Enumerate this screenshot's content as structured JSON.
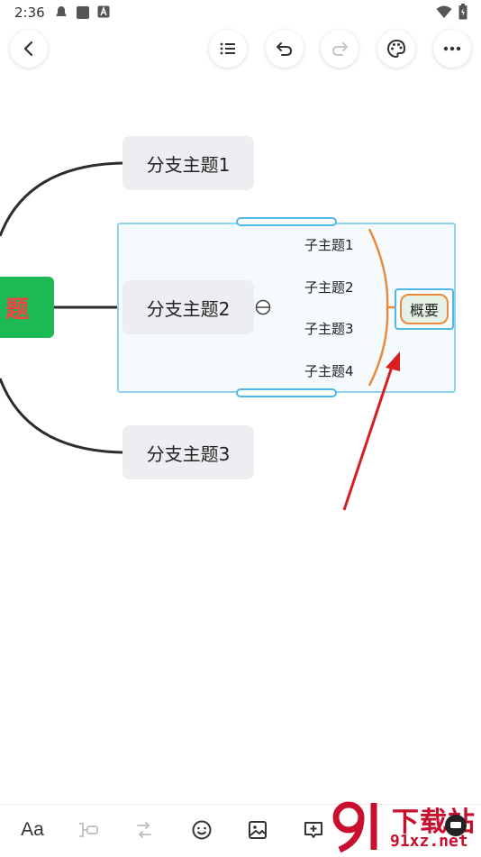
{
  "status_bar": {
    "time": "2:36"
  },
  "toolbar": {
    "back": "back-icon",
    "outline": "list-icon",
    "undo": "undo-icon",
    "redo": "redo-icon",
    "theme": "palette-icon",
    "more": "more-icon"
  },
  "mindmap": {
    "root_label": "题",
    "branches": [
      {
        "label": "分支主题1"
      },
      {
        "label": "分支主题2"
      },
      {
        "label": "分支主题3"
      }
    ],
    "subtopics": [
      {
        "label": "子主题1"
      },
      {
        "label": "子主题2"
      },
      {
        "label": "子主题3"
      },
      {
        "label": "子主题4"
      }
    ],
    "summary_label": "概要"
  },
  "bottom_toolbar": {
    "font_label": "Aa",
    "icons": [
      "subtopic-icon",
      "relationship-icon",
      "emoji-icon",
      "image-icon",
      "comment-icon"
    ]
  },
  "watermark": {
    "brand": "下载站",
    "url": "91xz.net"
  },
  "colors": {
    "root": "#1db954",
    "root_text": "#ee4444",
    "selection": "#8fd3ef",
    "summary_bracket": "#e98a3c",
    "arrow": "#d81e1e"
  }
}
